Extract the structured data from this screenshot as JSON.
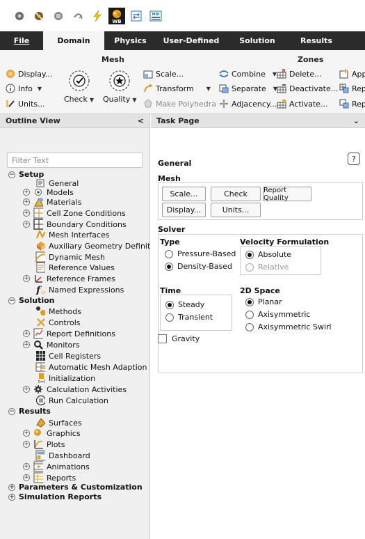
{
  "colors": {
    "tab_bar": "#2b2b2b",
    "ribbon_bg": "#f5f5f5",
    "panel_bg": "#f0f0f0"
  },
  "quick_access": [
    {
      "name": "open-icon"
    },
    {
      "name": "save-icon"
    },
    {
      "name": "print-icon"
    },
    {
      "name": "undo-icon"
    },
    {
      "name": "lightning-icon"
    },
    {
      "name": "workbench-icon",
      "label": "WB"
    },
    {
      "name": "converter-icon"
    },
    {
      "name": "mdi-icon",
      "label": "MDI"
    }
  ],
  "tabs": {
    "file": "File",
    "domain": "Domain",
    "physics": "Physics",
    "user_defined": "User-Defined",
    "solution": "Solution",
    "results": "Results"
  },
  "ribbon": {
    "mesh": {
      "title": "Mesh",
      "display": "Display...",
      "info": "Info",
      "units": "Units...",
      "check": "Check",
      "quality": "Quality",
      "scale": "Scale...",
      "transform": "Transform",
      "make_polyhedra": "Make Polyhedra"
    },
    "zones": {
      "title": "Zones",
      "combine": "Combine",
      "separate": "Separate",
      "adjacency": "Adjacency...",
      "delete": "Delete...",
      "deactivate": "Deactivate...",
      "activate": "Activate...",
      "append": "Appe",
      "replace1": "Repl",
      "replace2": "Repl"
    }
  },
  "outline": {
    "title": "Outline View",
    "collapse": "<",
    "filter_placeholder": "Filter Text",
    "items": [
      {
        "label": "Setup",
        "level": 0,
        "exp": "−",
        "bold": true
      },
      {
        "label": "General",
        "level": 2
      },
      {
        "label": "Models",
        "level": 1,
        "exp": "+"
      },
      {
        "label": "Materials",
        "level": 1,
        "exp": "+"
      },
      {
        "label": "Cell Zone Conditions",
        "level": 1,
        "exp": "+"
      },
      {
        "label": "Boundary Conditions",
        "level": 1,
        "exp": "+"
      },
      {
        "label": "Mesh Interfaces",
        "level": 2
      },
      {
        "label": "Auxiliary Geometry Definitions",
        "level": 2
      },
      {
        "label": "Dynamic Mesh",
        "level": 2
      },
      {
        "label": "Reference Values",
        "level": 2
      },
      {
        "label": "Reference Frames",
        "level": 1,
        "exp": "+"
      },
      {
        "label": "Named Expressions",
        "level": 2
      },
      {
        "label": "Solution",
        "level": 0,
        "exp": "−",
        "bold": true
      },
      {
        "label": "Methods",
        "level": 2
      },
      {
        "label": "Controls",
        "level": 2
      },
      {
        "label": "Report Definitions",
        "level": 1,
        "exp": "+"
      },
      {
        "label": "Monitors",
        "level": 1,
        "exp": "+"
      },
      {
        "label": "Cell Registers",
        "level": 2
      },
      {
        "label": "Automatic Mesh Adaption",
        "level": 2
      },
      {
        "label": "Initialization",
        "level": 2
      },
      {
        "label": "Calculation Activities",
        "level": 1,
        "exp": "+"
      },
      {
        "label": "Run Calculation",
        "level": 2
      },
      {
        "label": "Results",
        "level": 0,
        "exp": "−",
        "bold": true
      },
      {
        "label": "Surfaces",
        "level": 2
      },
      {
        "label": "Graphics",
        "level": 1,
        "exp": "+"
      },
      {
        "label": "Plots",
        "level": 1,
        "exp": "+"
      },
      {
        "label": "Dashboard",
        "level": 2
      },
      {
        "label": "Animations",
        "level": 1,
        "exp": "+"
      },
      {
        "label": "Reports",
        "level": 1,
        "exp": "+"
      },
      {
        "label": "Parameters & Customization",
        "level": 0,
        "exp": "+",
        "bold": true
      },
      {
        "label": "Simulation Reports",
        "level": 0,
        "exp": "+",
        "bold": true
      }
    ]
  },
  "task": {
    "title": "Task Page",
    "caret": "⌄",
    "heading": "General",
    "help": "?",
    "mesh": {
      "label": "Mesh",
      "scale": "Scale...",
      "check": "Check",
      "report_quality": "Report Quality",
      "display": "Display...",
      "units": "Units..."
    },
    "solver": {
      "label": "Solver",
      "type": {
        "label": "Type",
        "pressure": "Pressure-Based",
        "density": "Density-Based"
      },
      "velocity": {
        "label": "Velocity Formulation",
        "absolute": "Absolute",
        "relative": "Relative"
      },
      "time": {
        "label": "Time",
        "steady": "Steady",
        "transient": "Transient"
      },
      "space": {
        "label": "2D Space",
        "planar": "Planar",
        "axisymmetric": "Axisymmetric",
        "axisymmetric_swirl": "Axisymmetric Swirl"
      }
    },
    "gravity": "Gravity"
  }
}
